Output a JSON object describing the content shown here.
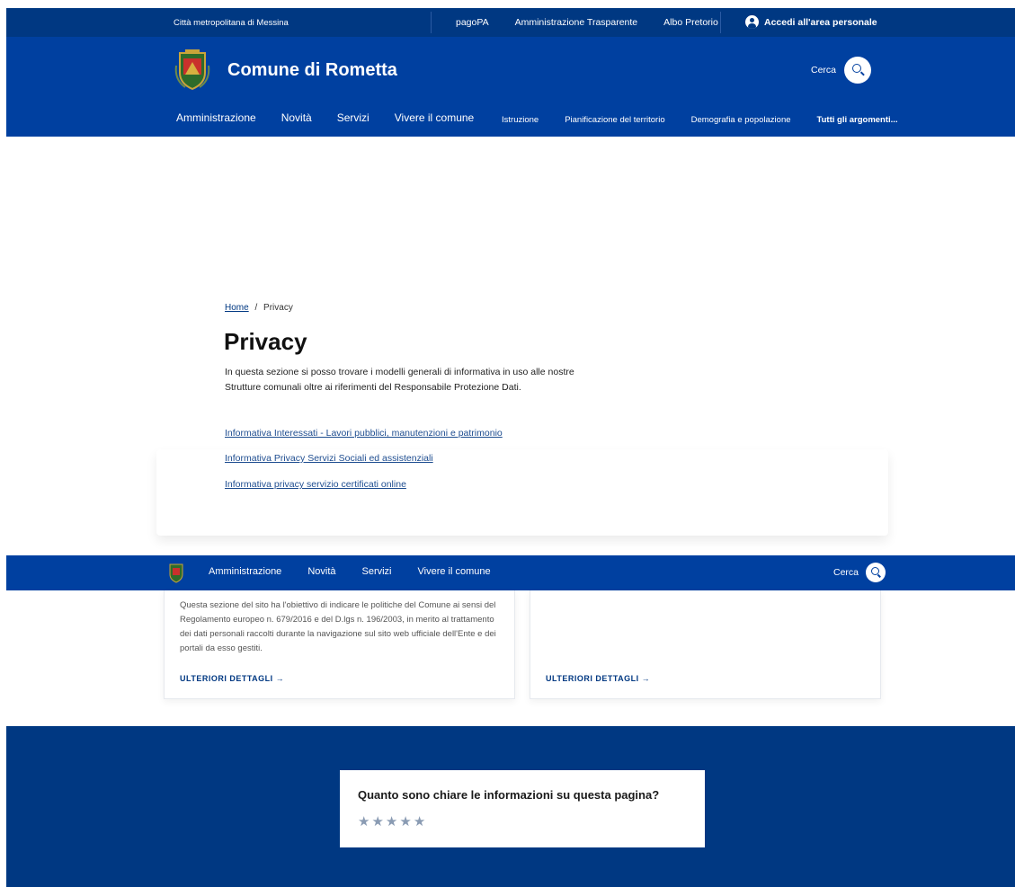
{
  "topbar": {
    "region": "Città metropolitana di Messina",
    "links": [
      "pagoPA",
      "Amministrazione Trasparente",
      "Albo Pretorio"
    ],
    "login": "Accedi all'area personale"
  },
  "header": {
    "title": "Comune di Rometta",
    "search_label": "Cerca",
    "main_nav": [
      "Amministrazione",
      "Novità",
      "Servizi",
      "Vivere il comune"
    ],
    "topics": [
      "Istruzione",
      "Pianificazione del territorio",
      "Demografia e popolazione"
    ],
    "all_topics": "Tutti gli argomenti..."
  },
  "breadcrumb": {
    "home": "Home",
    "separator": "/",
    "current": "Privacy"
  },
  "page": {
    "title": "Privacy",
    "intro": "In questa sezione si posso trovare i modelli generali di informativa in uso alle nostre Strutture comunali oltre ai riferimenti del Responsabile Protezione Dati.",
    "documents": [
      "Informativa Interessati - Lavori pubblici, manutenzioni e patrimonio",
      "Informativa Privacy Servizi Sociali ed assistenziali",
      "Informativa privacy servizio certificati online"
    ]
  },
  "sticky_nav": {
    "items": [
      "Amministrazione",
      "Novità",
      "Servizi",
      "Vivere il comune"
    ],
    "search_label": "Cerca"
  },
  "cards": [
    {
      "description": "Questa sezione del sito ha l'obiettivo di indicare le politiche del Comune ai sensi del Regolamento europeo n. 679/2016 e del D.lgs n. 196/2003, in merito al trattamento dei dati personali raccolti durante la navigazione sul sito web ufficiale dell'Ente e dei portali da esso gestiti.",
      "more": "ULTERIORI DETTAGLI →"
    },
    {
      "description": "",
      "more": "ULTERIORI DETTAGLI →"
    }
  ],
  "feedback": {
    "question": "Quanto sono chiare le informazioni su questa pagina?",
    "stars": [
      "★",
      "★",
      "★",
      "★",
      "★"
    ]
  },
  "colors": {
    "primary": "#0040a0",
    "topbar": "#003882",
    "link": "#1e4d90"
  }
}
